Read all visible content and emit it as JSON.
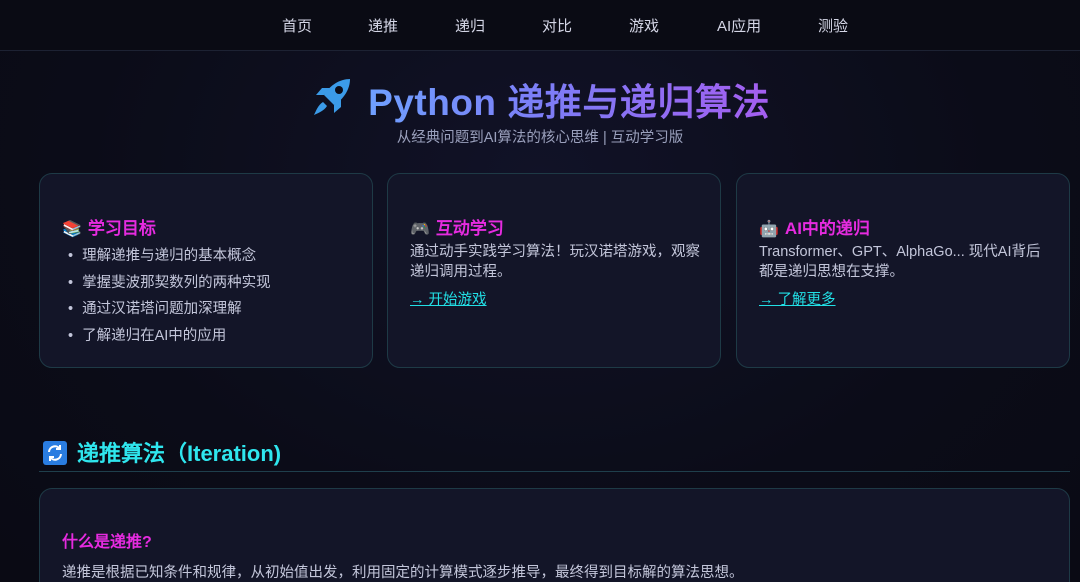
{
  "nav": {
    "items": [
      "首页",
      "递推",
      "递归",
      "对比",
      "游戏",
      "AI应用",
      "测验"
    ]
  },
  "hero": {
    "title": "Python 递推与递归算法",
    "subtitle": "从经典问题到AI算法的核心思维 | 互动学习版",
    "icon": "rocket-icon"
  },
  "cards": {
    "goals": {
      "emoji": "📚",
      "title": "学习目标",
      "items": [
        "理解递推与递归的基本概念",
        "掌握斐波那契数列的两种实现",
        "通过汉诺塔问题加深理解",
        "了解递归在AI中的应用"
      ]
    },
    "interactive": {
      "emoji": "🎮",
      "title": "互动学习",
      "text": "通过动手实践学习算法！玩汉诺塔游戏，观察递归调用过程。",
      "link": "→ 开始游戏"
    },
    "ai": {
      "emoji": "🤖",
      "title": "AI中的递归",
      "text": "Transformer、GPT、AlphaGo... 现代AI背后都是递归思想在支撑。",
      "link": "→ 了解更多"
    }
  },
  "section": {
    "title": "递推算法（Iteration)",
    "icon": "sync-icon"
  },
  "iteration_card": {
    "heading": "什么是递推?",
    "text": "递推是根据已知条件和规律，从初始值出发，利用固定的计算模式逐步推导，最终得到目标解的算法思想。"
  },
  "colors": {
    "accent_magenta": "#e62be0",
    "accent_cyan": "#22e0e6",
    "background": "#0b0c18"
  }
}
